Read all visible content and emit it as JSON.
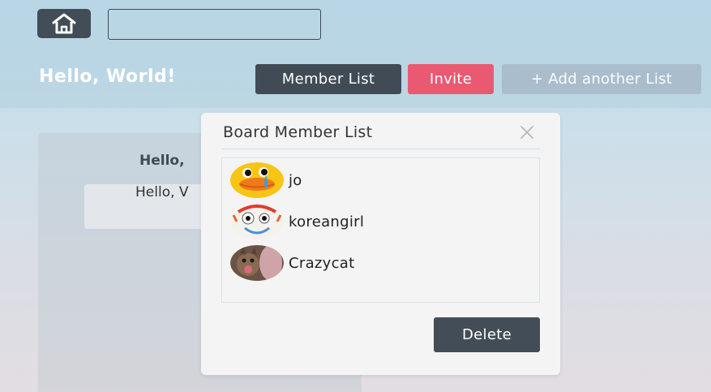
{
  "header": {
    "home_icon": "home-icon",
    "search": {
      "value": "",
      "placeholder": ""
    }
  },
  "board": {
    "title": "Hello, World!",
    "buttons": {
      "member_list": "Member List",
      "invite": "Invite",
      "add_list": "+ Add another List"
    }
  },
  "list": {
    "title": "Hello,",
    "card_text": "Hello, V"
  },
  "modal": {
    "title": "Board Member List",
    "close_icon": "close-icon",
    "members": [
      {
        "name": "jo",
        "avatar": "duck-avatar"
      },
      {
        "name": "koreangirl",
        "avatar": "forky-avatar"
      },
      {
        "name": "Crazycat",
        "avatar": "cat-avatar"
      }
    ],
    "delete_label": "Delete"
  },
  "colors": {
    "primary_dark": "#434d57",
    "invite_pink": "#e95a72",
    "add_list_gray": "#a9bccb"
  }
}
